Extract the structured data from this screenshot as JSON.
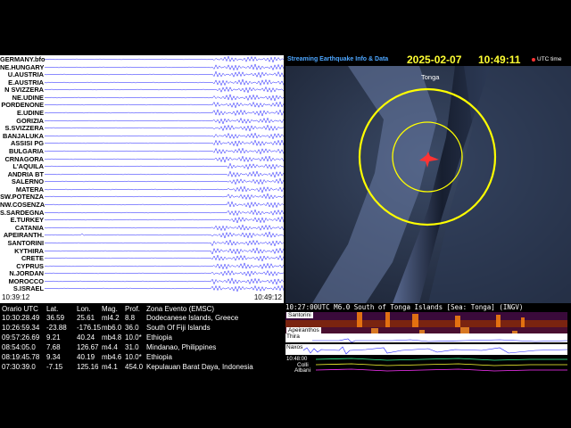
{
  "stations": [
    "GERMANY.bfo",
    "NE.HUNGARY",
    "U.AUSTRIA",
    "E.AUSTRIA",
    "N SVIZZERA",
    "NE.UDINE",
    "PORDENONE",
    "E.UDINE",
    "GORIZIA",
    "S.SVIZZERA",
    "BANJALUKA",
    "ASSISI PG",
    "BULGARIA",
    "CRNAGORA",
    "L'AQUILA",
    "ANDRIA BT",
    "SALERNO",
    "MATERA",
    "SW.POTENZA",
    "NW.COSENZA",
    "S.SARDEGNA",
    "E.TURKEY",
    "CATANIA",
    "APEIRANTH.",
    "SANTORINI",
    "KYTHIRA",
    "CRETE",
    "CYPRUS",
    "N.JORDAN",
    "MOROCCO",
    "S.ISRAEL"
  ],
  "seis_time_start": "10:39:12",
  "seis_time_end": "10:49:12",
  "header": {
    "title": "Streaming  Earthquake Info & Data",
    "date": "2025-02-07",
    "time": "10:49:11",
    "utc_label": "UTC time"
  },
  "map": {
    "place_label": "Tonga"
  },
  "caption": "10:27:00UTC M6.0 South of Tonga Islands [Sea: Tonga] (INGV)",
  "spectro": {
    "s1": "Santorini",
    "s2": "Apeiranthos",
    "s3": "Thira",
    "s4": "Naxos"
  },
  "bottom": {
    "time": "10:48:00",
    "colli": "Colli",
    "albani": "Albani"
  },
  "table": {
    "headers": [
      "Orario UTC",
      "Lat.",
      "Lon.",
      "Mag.",
      "Prof.",
      "Zona Evento (EMSC)"
    ],
    "rows": [
      [
        "10:30:28.49",
        "36.59",
        "25.61",
        "ml4.2",
        "8.8",
        "Dodecanese Islands, Greece"
      ],
      [
        "10:26:59.34",
        "-23.88",
        "-176.15",
        "mb6.0",
        "36.0",
        "South Of Fiji Islands"
      ],
      [
        "09:57:26.69",
        "9.21",
        "40.24",
        "mb4.8",
        "10.0*",
        "Ethiopia"
      ],
      [
        "08:54:05.0",
        "7.68",
        "126.67",
        "m4.4",
        "31.0",
        "Mindanao, Philippines"
      ],
      [
        "08:19:45.78",
        "9.34",
        "40.19",
        "mb4.6",
        "10.0*",
        "Ethiopia"
      ],
      [
        "07:30:39.0",
        "-7.15",
        "125.16",
        "m4.1",
        "454.0",
        "Kepulauan Barat Daya, Indonesia"
      ]
    ]
  },
  "colors": {
    "trace": "#1a1aff",
    "header_accent": "#ffff33",
    "map_circle": "#ffff00",
    "epicenter": "#ff3333"
  }
}
